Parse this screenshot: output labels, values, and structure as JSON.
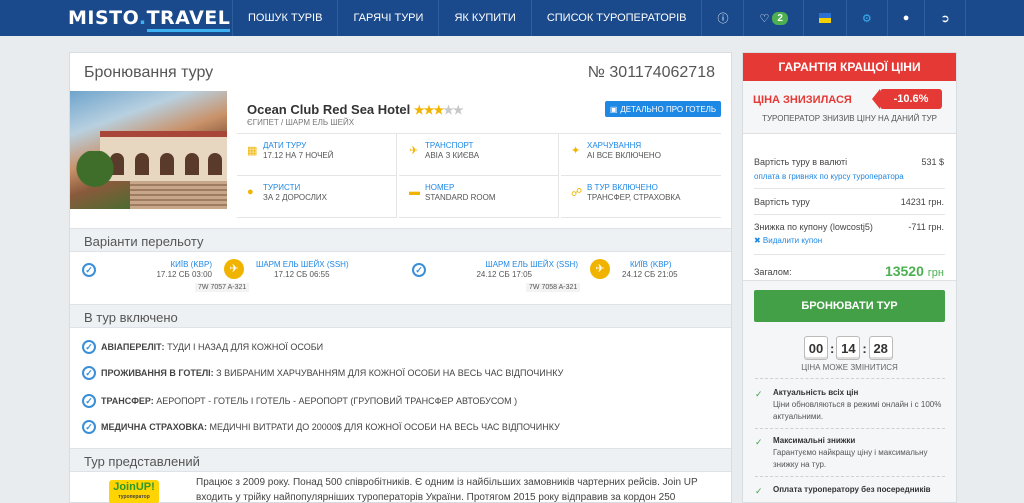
{
  "header": {
    "logo_main": "MISTO",
    "logo_dot": ".",
    "logo_tail": "TRAVEL",
    "nav": [
      "ПОШУК ТУРІВ",
      "ГАРЯЧІ ТУРИ",
      "ЯК КУПИТИ",
      "СПИСОК ТУРОПЕРАТОРІВ"
    ],
    "favorites_count": "2",
    "colors": {
      "bar": "#1a4a8c",
      "accent": "#3cb0f0"
    }
  },
  "booking": {
    "title": "Бронювання туру",
    "order_number": "№ 301174062718",
    "hotel_name": "Ocean Club Red Sea Hotel",
    "stars_filled": "★★★",
    "stars_empty": "★★",
    "location": "ЄГИПЕТ / ШАРМ ЕЛЬ ШЕЙХ",
    "detail_button": "ДЕТАЛЬНО ПРО ГОТЕЛЬ",
    "info": [
      {
        "label": "ДАТИ ТУРУ",
        "value": "17.12 НА 7 НОЧЕЙ",
        "icon": "calendar-icon"
      },
      {
        "label": "ТРАНСПОРТ",
        "value": "АВІА З КИЄВА",
        "icon": "plane-icon"
      },
      {
        "label": "ХАРЧУВАННЯ",
        "value": "AI ВСЕ ВКЛЮЧЕНО",
        "icon": "cutlery-icon"
      },
      {
        "label": "ТУРИСТИ",
        "value": "ЗА 2 ДОРОСЛИХ",
        "icon": "users-icon"
      },
      {
        "label": "НОМЕР",
        "value": "STANDARD ROOM",
        "icon": "bed-icon"
      },
      {
        "label": "В ТУР ВКЛЮЧЕНО",
        "value": "ТРАНСФЕР, СТРАХОВКА",
        "icon": "shield-icon"
      }
    ]
  },
  "flights": {
    "section_title": "Варіанти перельоту",
    "outbound": {
      "from_city": "КИЇВ (KBP)",
      "from_date": "17.12 СБ 03:00",
      "to_city": "ШАРМ ЕЛЬ ШЕЙХ (SSH)",
      "to_date": "17.12 СБ 06:55",
      "code": "7W 7057 A-321"
    },
    "return": {
      "from_city": "ШАРМ ЕЛЬ ШЕЙХ (SSH)",
      "from_date": "24.12 СБ 17:05",
      "to_city": "КИЇВ (KBP)",
      "to_date": "24.12 СБ 21:05",
      "code": "7W 7058 A-321"
    }
  },
  "included": {
    "section_title": "В тур включено",
    "items": [
      {
        "key": "АВІАПЕРЕЛІТ:",
        "text": " ТУДИ І НАЗАД ДЛЯ КОЖНОЇ ОСОБИ"
      },
      {
        "key": "ПРОЖИВАННЯ В ГОТЕЛІ:",
        "text": " З ВИБРАНИМ ХАРЧУВАННЯМ ДЛЯ КОЖНОЇ ОСОБИ НА ВЕСЬ ЧАС ВІДПОЧИНКУ"
      },
      {
        "key": "ТРАНСФЕР:",
        "text": " АЕРОПОРТ - ГОТЕЛЬ І ГОТЕЛЬ - АЕРОПОРТ (ГРУПОВИЙ ТРАНСФЕР АВТОБУСОМ )"
      },
      {
        "key": "МЕДИЧНА СТРАХОВКА:",
        "text": " МЕДИЧНІ ВИТРАТИ ДО 20000$ ДЛЯ КОЖНОЇ ОСОБИ НА ВЕСЬ ЧАС ВІДПОЧИНКУ"
      }
    ]
  },
  "operator": {
    "section_title": "Тур представлений",
    "logo_text": "JoinUP!",
    "logo_sub": "туроператор",
    "description": "Працює з 2009 року. Понад 500 співробітників. Є одним із найбільших замовників чартерних рейсів. Join UP входить у трійку найпопулярніших туроператорів України. Протягом 2015 року відправив за кордон 250"
  },
  "sidebar": {
    "guarantee": "ГАРАНТІЯ КРАЩОЇ ЦІНИ",
    "price_drop": "ЦІНА ЗНИЗИЛАСЯ",
    "percent": "-10.6%",
    "drop_note": "ТУРОПЕРАТОР ЗНИЗИВ ЦІНУ НА ДАНИЙ ТУР",
    "currency_label": "Вартість туру в валюті",
    "currency_value": "531 $",
    "currency_link": "оплата в гривнях по курсу туроператора",
    "price_label": "Вартість туру",
    "price_value": "14231 грн.",
    "coupon_label": "Знижка по купону (lowcostj5)",
    "coupon_value": "-711 грн.",
    "coupon_remove": "✖ Видалити купон",
    "total_label": "Загалом:",
    "total_value": "13520",
    "total_currency": "грн",
    "book_button": "БРОНЮВАТИ ТУР",
    "timer": [
      "00",
      "14",
      "28"
    ],
    "timer_note": "ЦІНА МОЖЕ ЗМІНИТИСЯ",
    "advantages": [
      {
        "title": "Актуальність всіх цін",
        "desc": "Ціни обновляються в режимі онлайн і с 100% актуальними."
      },
      {
        "title": "Максимальні знижки",
        "desc": "Гарантуємо найкращу ціну і максимальну знижку на тур."
      },
      {
        "title": "Оплата туроператору без посередників",
        "desc": ""
      }
    ],
    "colors": {
      "red": "#e53935",
      "green": "#43a047"
    }
  }
}
